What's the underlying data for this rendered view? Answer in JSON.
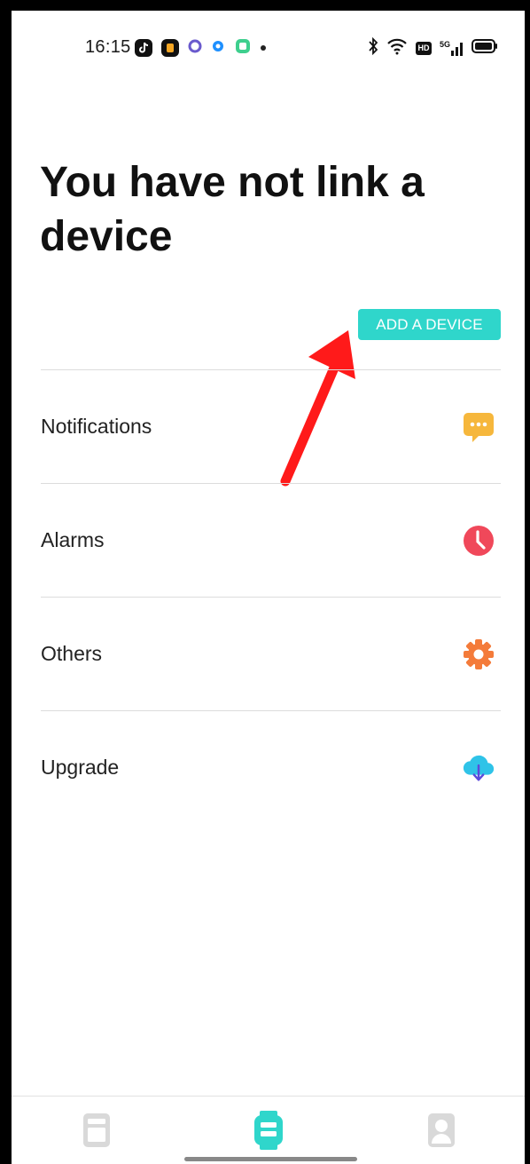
{
  "status_bar": {
    "time": "16:15",
    "network": "5G",
    "hd_label": "HD"
  },
  "page": {
    "title": "You have not link a device",
    "add_device_label": "ADD A DEVICE"
  },
  "menu": {
    "items": [
      {
        "label": "Notifications",
        "icon": "chat-bubble-icon",
        "color": "#f6b73c"
      },
      {
        "label": "Alarms",
        "icon": "clock-icon",
        "color": "#f0485a"
      },
      {
        "label": "Others",
        "icon": "gear-icon",
        "color": "#f47b3a"
      },
      {
        "label": "Upgrade",
        "icon": "cloud-download-icon",
        "color": "#2fc3e8"
      }
    ]
  },
  "bottom_nav": {
    "items": [
      {
        "icon": "record-icon",
        "active": false
      },
      {
        "icon": "watch-icon",
        "active": true
      },
      {
        "icon": "profile-icon",
        "active": false
      }
    ]
  },
  "colors": {
    "accent": "#2fd6cb",
    "annotation_arrow": "#ff1a1a",
    "inactive_icon": "#d9d9d9"
  }
}
